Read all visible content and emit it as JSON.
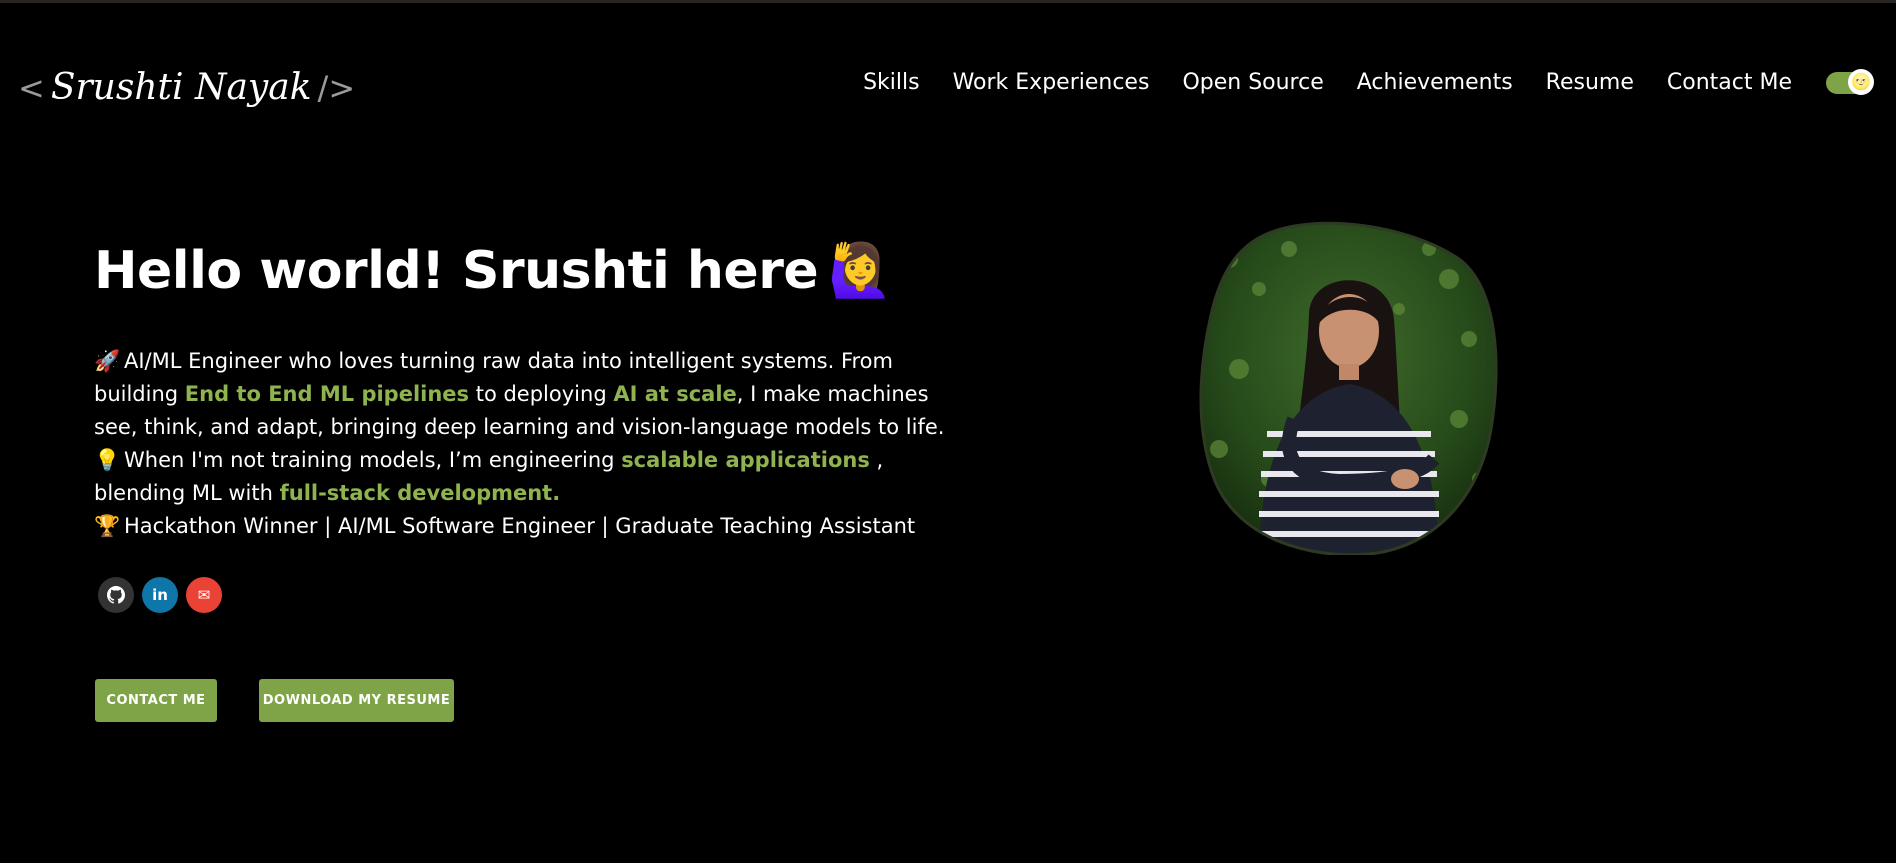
{
  "logo": {
    "open": "<",
    "name": "Srushti Nayak",
    "close": "/>"
  },
  "nav": [
    "Skills",
    "Work Experiences",
    "Open Source",
    "Achievements",
    "Resume",
    "Contact Me"
  ],
  "theme_toggle": {
    "state": "on",
    "knob_emoji": "🌝"
  },
  "hero": {
    "title": "Hello world! Srushti here",
    "title_emoji": "🙋‍♀️",
    "bio": {
      "l1_emoji": "🚀",
      "l1_a": "AI/ML Engineer who loves turning raw data into intelligent systems. From building ",
      "l1_hl1": "End to End ML pipelines",
      "l1_b": " to deploying ",
      "l1_hl2": "AI at scale",
      "l1_c": ", I make machines see, think, and adapt, bringing deep learning and vision-language models to life.",
      "l2_emoji": "💡",
      "l2_a": "When I'm not training models, I’m engineering ",
      "l2_hl1": "scalable applications",
      "l2_b": " , blending ML with ",
      "l2_hl2": "full-stack development.",
      "l3_emoji": "🏆",
      "l3": "Hackathon Winner | AI/ML Software Engineer | Graduate Teaching Assistant"
    }
  },
  "socials": [
    {
      "icon": "github-icon",
      "glyph": "●"
    },
    {
      "icon": "linkedin-icon",
      "glyph": "in"
    },
    {
      "icon": "email-icon",
      "glyph": "✉"
    }
  ],
  "buttons": {
    "contact": "Contact Me",
    "resume": "Download My Resume"
  },
  "colors": {
    "accent": "#7fa347",
    "highlight": "#8fb34f",
    "background": "#000000"
  }
}
